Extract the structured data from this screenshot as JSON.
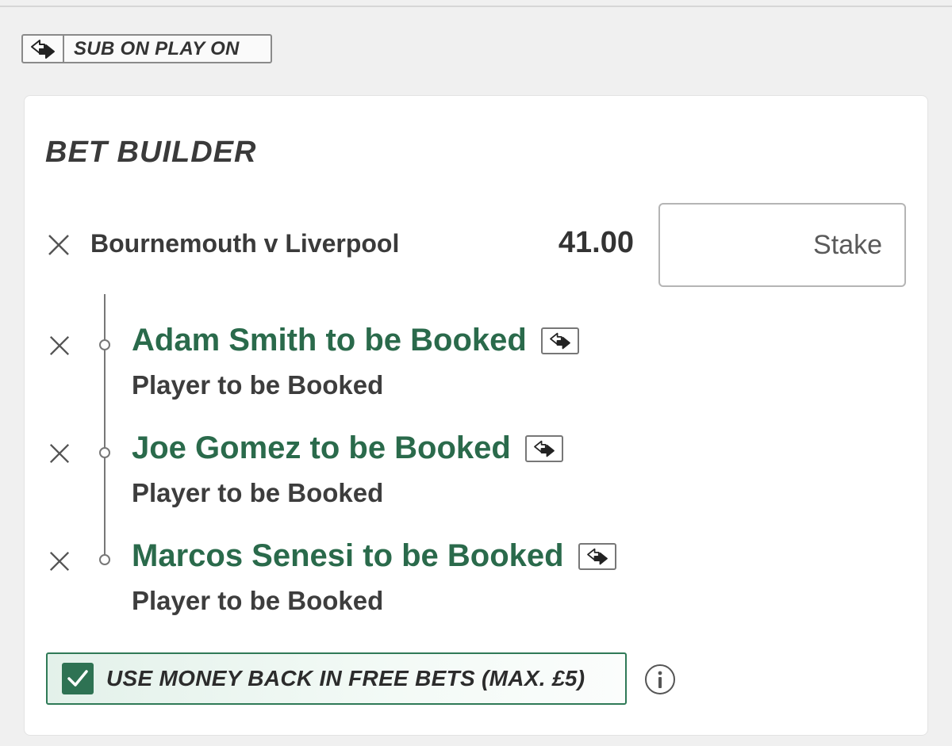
{
  "badge": {
    "label": "SUB ON PLAY ON",
    "icon": "swap-arrow-icon"
  },
  "bet_builder": {
    "title": "BET BUILDER",
    "match": "Bournemouth v Liverpool",
    "odds": "41.00",
    "stake_placeholder": "Stake",
    "legs": [
      {
        "title": "Adam Smith to be Booked",
        "market": "Player to be Booked"
      },
      {
        "title": "Joe Gomez to be Booked",
        "market": "Player to be Booked"
      },
      {
        "title": "Marcos Senesi to be Booked",
        "market": "Player to be Booked"
      }
    ],
    "money_back": {
      "label": "USE MONEY BACK IN FREE BETS (MAX. £5)",
      "checked": true
    }
  },
  "colors": {
    "accent_green": "#2a6a4b",
    "checkbox_green": "#2e7253",
    "background": "#f0f0f0"
  }
}
